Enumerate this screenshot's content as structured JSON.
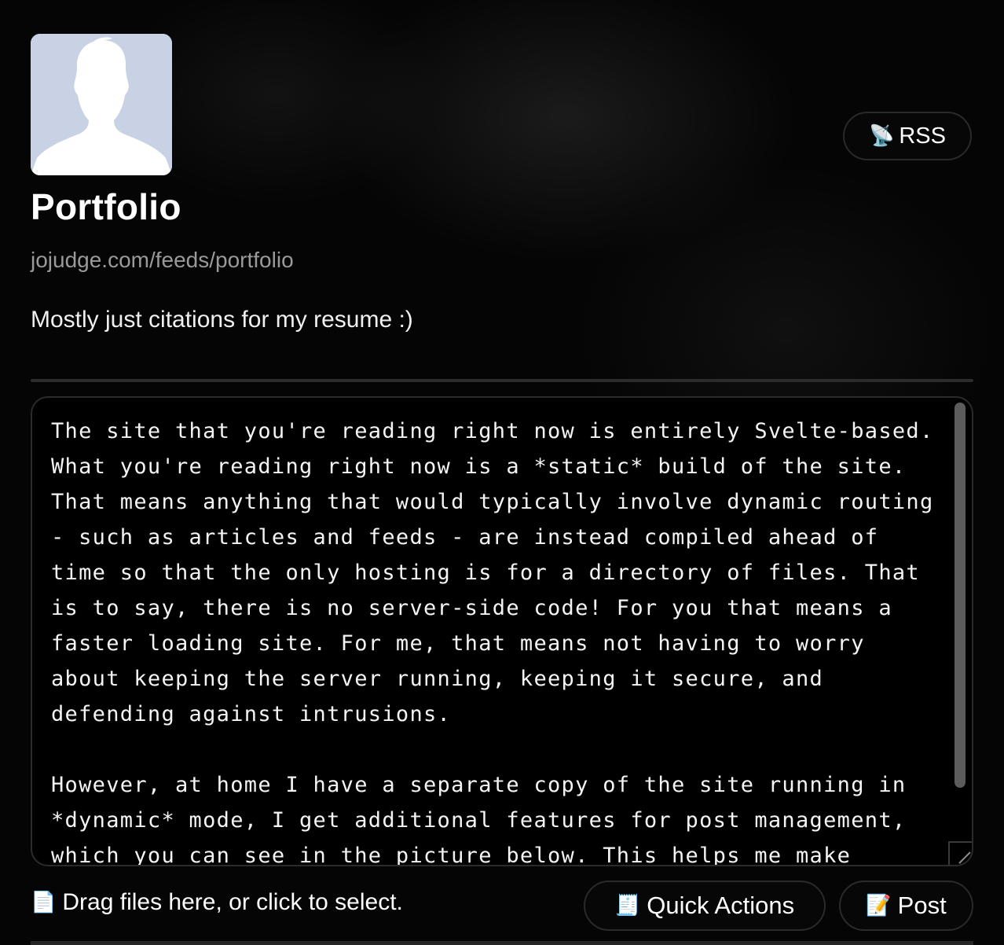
{
  "profile": {
    "title": "Portfolio",
    "url": "jojudge.com/feeds/portfolio",
    "description": "Mostly just citations for my resume :)",
    "avatar_icon": "default-user-silhouette-icon"
  },
  "header": {
    "rss_icon": "📡",
    "rss_label": "RSS"
  },
  "editor": {
    "content": "The site that you're reading right now is entirely Svelte-based. What you're reading right now is a *static* build of the site. That means anything that would typically involve dynamic routing - such as articles and feeds - are instead compiled ahead of time so that the only hosting is for a directory of files. That is to say, there is no server-side code! For you that means a faster loading site. For me, that means not having to worry about keeping the server running, keeping it secure, and defending against intrusions.\n\nHowever, at home I have a separate copy of the site running in *dynamic* mode, I get additional features for post management, which you can see in the picture below. This helps me make"
  },
  "composer": {
    "dropzone_icon": "📄",
    "dropzone_label": "Drag files here, or click to select.",
    "quick_actions_icon": "🧾",
    "quick_actions_label": "Quick Actions",
    "post_icon": "📝",
    "post_label": "Post"
  },
  "colors": {
    "background": "#050505",
    "text": "#ffffff",
    "muted_text": "#9a9a9a",
    "border": "#2b2b2b",
    "avatar_bg": "#c9d2e4"
  }
}
